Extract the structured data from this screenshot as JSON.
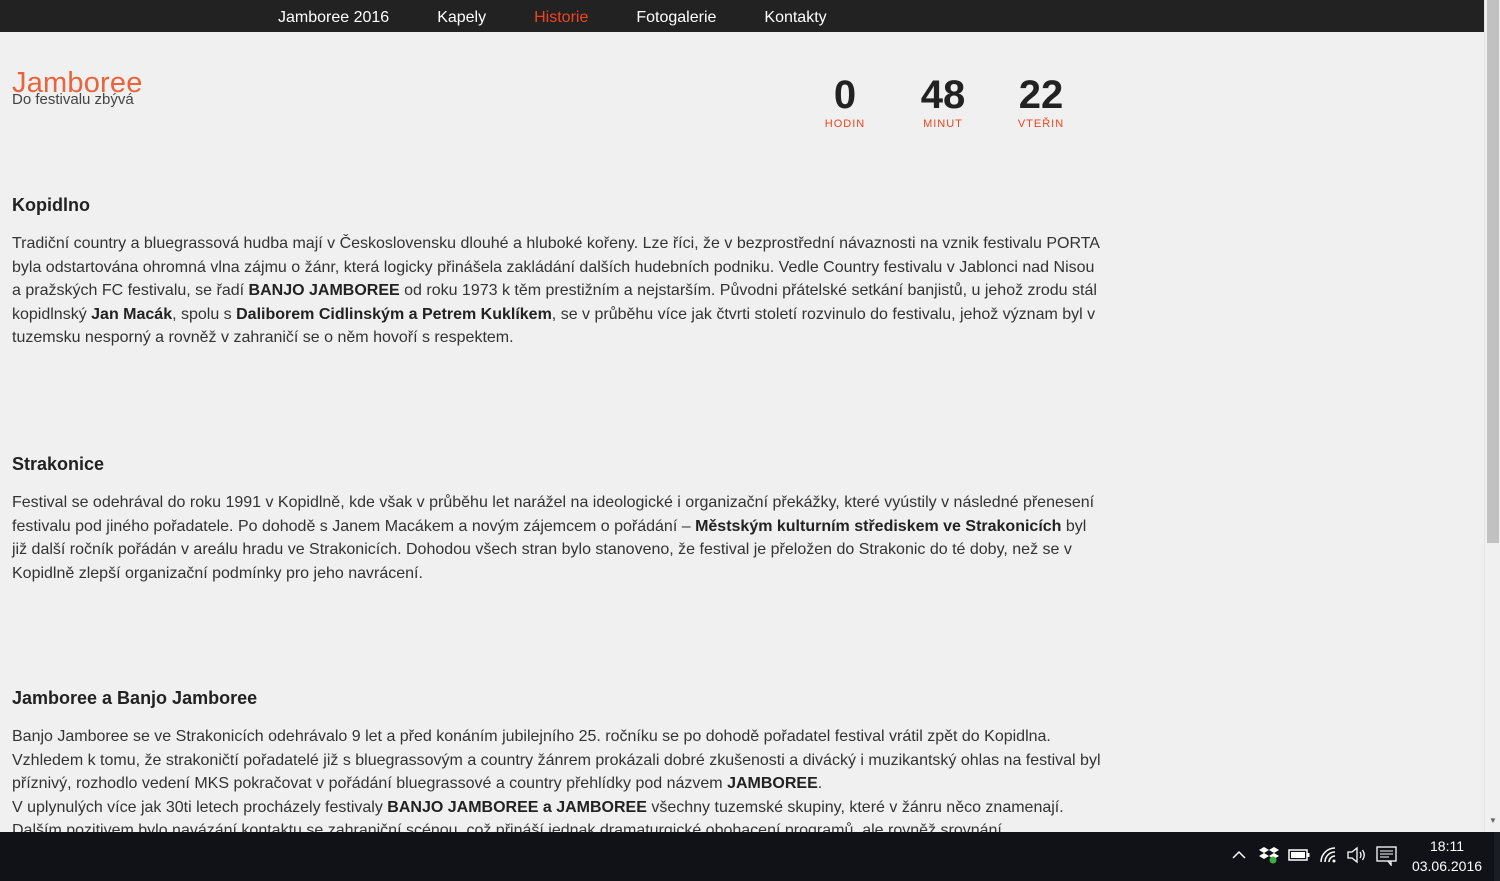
{
  "nav": {
    "items": [
      {
        "label": "Jamboree 2016"
      },
      {
        "label": "Kapely"
      },
      {
        "label": "Historie"
      },
      {
        "label": "Fotogalerie"
      },
      {
        "label": "Kontakty"
      }
    ],
    "active_index": 2
  },
  "brand": {
    "title": "Jamboree",
    "subtitle": "Do festivalu zbývá"
  },
  "countdown": {
    "hours": {
      "value": "0",
      "label": "HODIN"
    },
    "minutes": {
      "value": "48",
      "label": "MINUT"
    },
    "seconds": {
      "value": "22",
      "label": "VTEŘIN"
    }
  },
  "sections": [
    {
      "title": "Kopidlno",
      "html": "Tradiční country a bluegrassová hudba mají v Československu dlouhé a hluboké kořeny. Lze říci, že v bezprostřední návaznosti na vznik festivalu PORTA byla odstartována ohromná vlna zájmu o žánr, která logicky přinášela zakládání dalších hudebních podniku. Vedle Country festivalu v Jablonci nad Nisou a pražských FC festivalu, se řadí <b>BANJO JAMBOREE</b> od roku 1973 k těm prestižním a nejstarším. Původni přátelské setkání banjistů, u jehož zrodu stál kopidlnský <b>Jan Macák</b>, spolu s <b>Daliborem Cidlinským a Petrem Kuklíkem</b>, se v průběhu více jak čtvrti století rozvinulo do festivalu, jehož význam byl v tuzemsku nesporný a rovněž v zahraničí se o něm hovoří s respektem."
    },
    {
      "title": "Strakonice",
      "html": "Festival se odehrával do roku 1991 v Kopidlně, kde však v průběhu let narážel na ideologické i organizační překážky, které vyústily v následné přenesení festivalu pod jiného pořadatele. Po dohodě s Janem Macákem a novým zájemcem o pořádání – <b>Městským kulturním střediskem ve Strakonicích</b> byl již další ročník pořádán v areálu hradu ve Strakonicích. Dohodou všech stran bylo stanoveno, že festival je přeložen do Strakonic do té doby, než se v Kopidlně zlepší organizační podmínky pro jeho navrácení."
    },
    {
      "title": "Jamboree a Banjo Jamboree",
      "html": "Banjo Jamboree se ve Strakonicích odehrávalo 9 let a před konáním jubilejního 25. ročníku se po dohodě pořadatel festival vrátil zpět do Kopidlna. Vzhledem k tomu, že strakoničtí pořadatelé již s bluegrassovým a country žánrem prokázali dobré zkušenosti a divácký i muzikantský ohlas na festival byl příznivý, rozhodlo vedení MKS pokračovat v pořádání bluegrassové a country přehlídky pod názvem <b>JAMBOREE</b>.<br>V uplynulých více jak 30ti letech procházely festivaly <b>BANJO JAMBOREE a JAMBOREE</b> všechny tuzemské skupiny, které v žánru něco znamenají.<br>Dalším pozitivem bylo navázání kontaktu se zahraniční scénou, což přináší jednak dramaturgické obohacení programů, ale rovněž srovnání"
    }
  ],
  "taskbar": {
    "time": "18:11",
    "date": "03.06.2016"
  }
}
